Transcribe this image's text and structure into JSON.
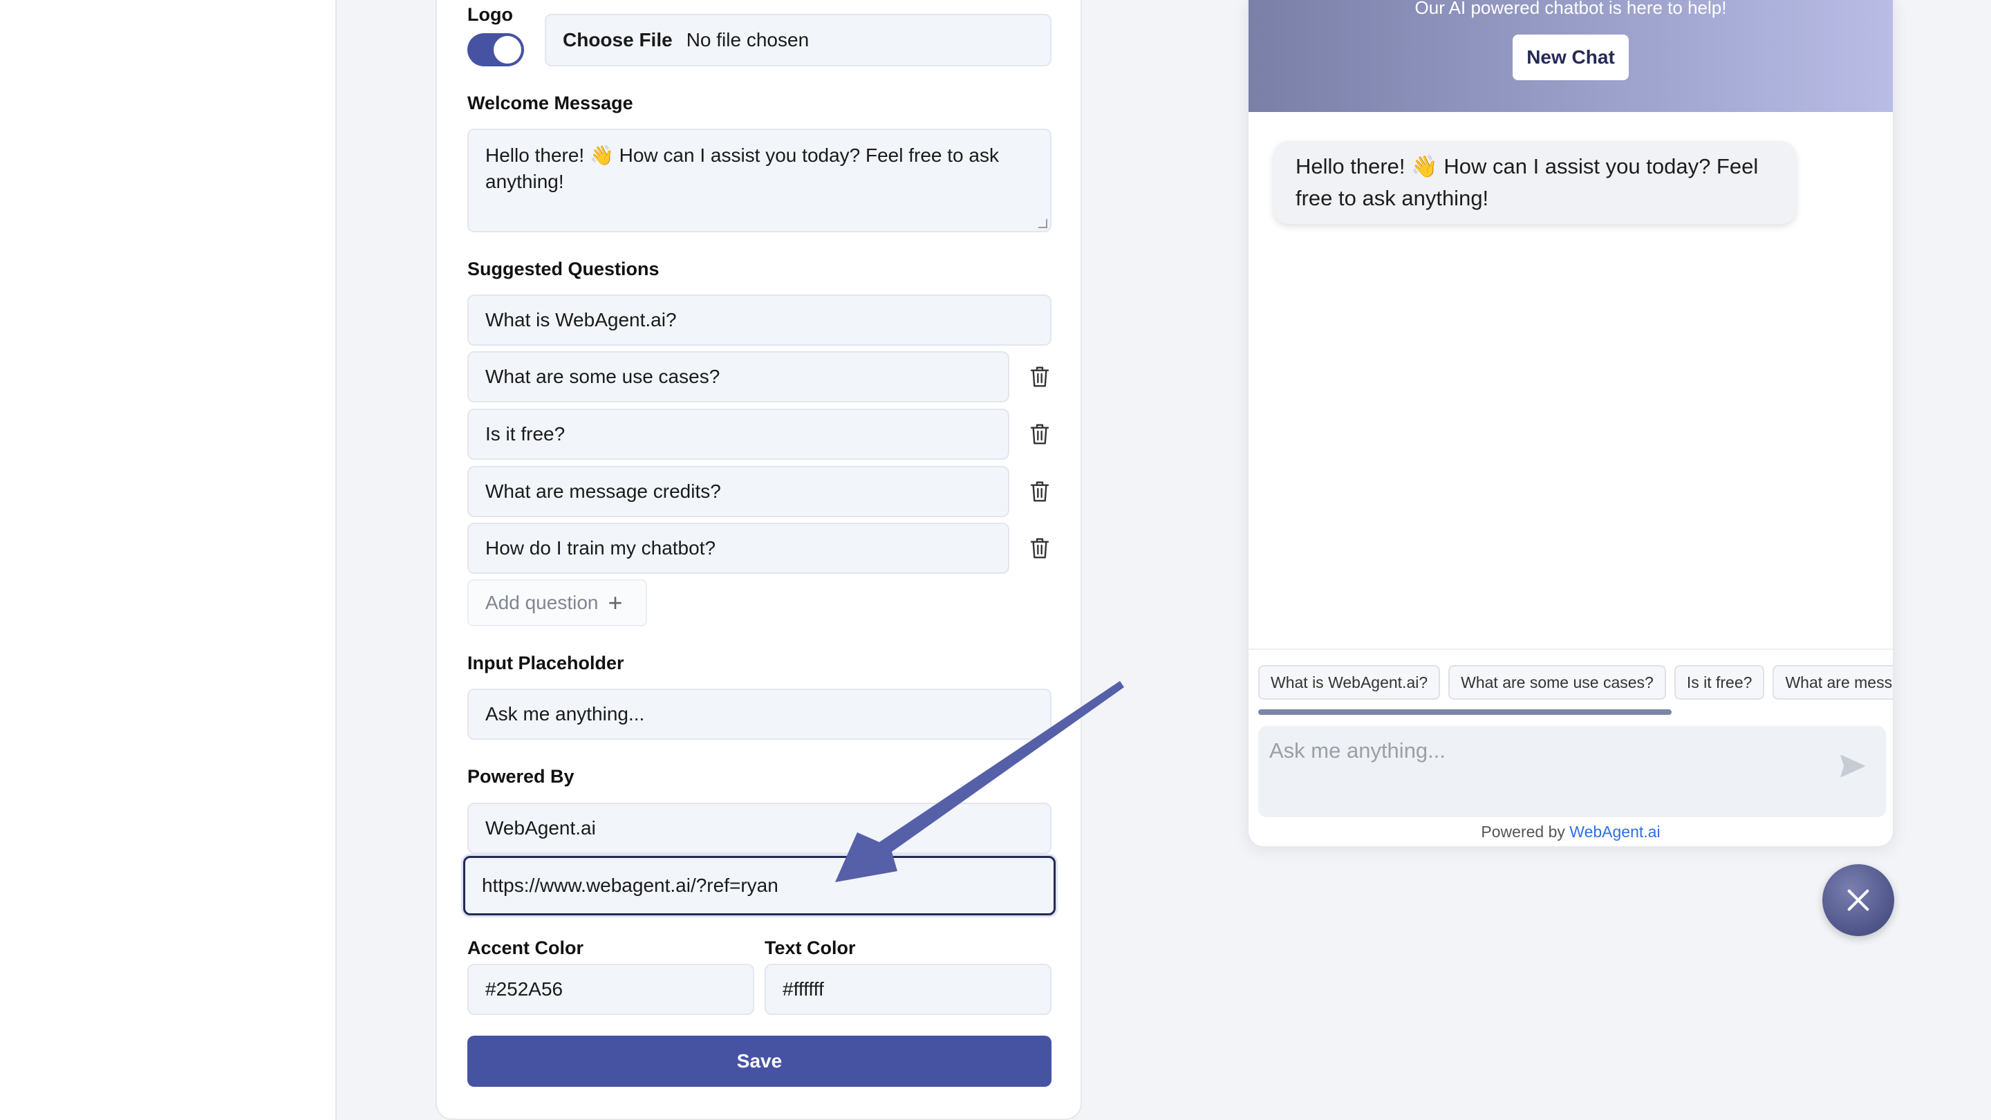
{
  "form": {
    "logo_label": "Logo",
    "choose_file": "Choose File",
    "no_file": "No file chosen",
    "welcome_label": "Welcome Message",
    "welcome_value": "Hello there! 👋 How can I assist you today? Feel free to ask anything!",
    "suggested_label": "Suggested Questions",
    "questions": [
      "What is WebAgent.ai?",
      "What are some use cases?",
      "Is it free?",
      "What are message credits?",
      "How do I train my chatbot?"
    ],
    "add_question": "Add question",
    "placeholder_label": "Input Placeholder",
    "placeholder_value": "Ask me anything...",
    "powered_label": "Powered By",
    "powered_name": "WebAgent.ai",
    "powered_url": "https://www.webagent.ai/?ref=ryan",
    "accent_label": "Accent Color",
    "accent_value": "#252A56",
    "text_label": "Text Color",
    "text_value": "#ffffff",
    "save": "Save"
  },
  "chat": {
    "subtitle": "Our AI powered chatbot is here to help!",
    "new_chat": "New Chat",
    "welcome": "Hello there! 👋 How can I assist you today? Feel free to ask anything!",
    "chips": [
      "What is WebAgent.ai?",
      "What are some use cases?",
      "Is it free?",
      "What are message credits?"
    ],
    "input_placeholder": "Ask me anything...",
    "powered_prefix": "Powered by",
    "powered_link": "WebAgent.ai"
  },
  "colors": {
    "accent": "#252A56",
    "button": "#4653a2",
    "arrow": "#5560a8",
    "link": "#2f6fde"
  },
  "icons": {
    "trash": "trash-icon",
    "send": "send-icon",
    "close": "close-icon",
    "plus": "plus-icon"
  }
}
